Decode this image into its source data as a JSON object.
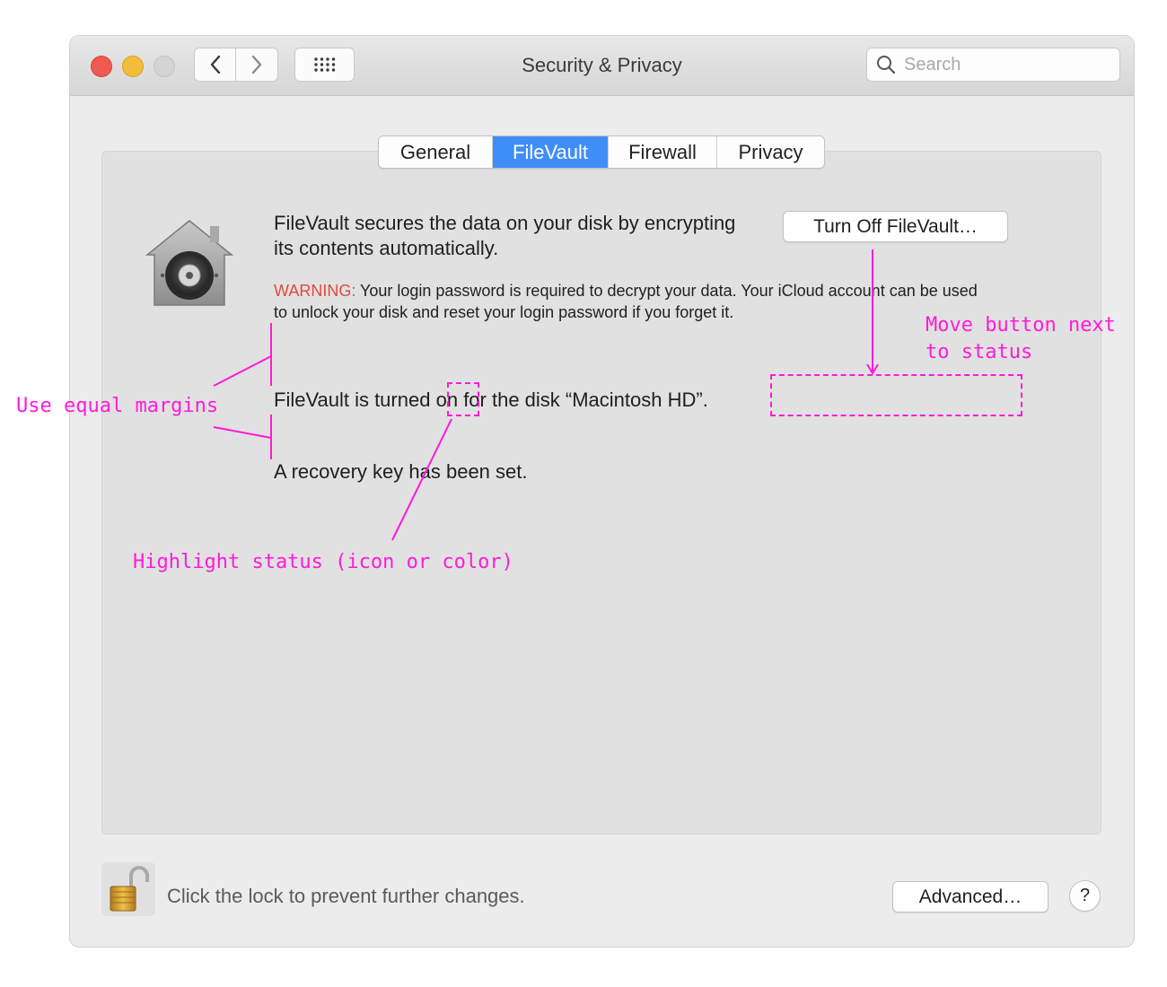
{
  "window": {
    "title": "Security & Privacy"
  },
  "toolbar": {
    "back_icon": "chevron-left-icon",
    "forward_icon": "chevron-right-icon",
    "grid_icon": "grid-icon",
    "search": {
      "placeholder": "Search",
      "value": "",
      "icon": "search-icon"
    }
  },
  "tabs": [
    {
      "label": "General",
      "active": false
    },
    {
      "label": "FileVault",
      "active": true
    },
    {
      "label": "Firewall",
      "active": false
    },
    {
      "label": "Privacy",
      "active": false
    }
  ],
  "filevault": {
    "icon": "filevault-vault-icon",
    "description": "FileVault secures the data on your disk by encrypting its contents automatically.",
    "turn_off_button": "Turn Off FileVault…",
    "warning_label": "WARNING:",
    "warning_text": " Your login password is required to decrypt your data. Your iCloud account can be used to unlock your disk and reset your login password if you forget it.",
    "status_prefix": "FileVault is turned",
    "status_value": "on",
    "status_suffix": "for the disk “Macintosh HD”.",
    "recovery": "A recovery key has been set."
  },
  "footer": {
    "lock_icon": "unlocked-padlock-icon",
    "lock_label": "Click the lock to prevent further changes.",
    "advanced_button": "Advanced…",
    "help_button": "?"
  },
  "annotations": {
    "equal_margins": "Use equal margins",
    "move_button": "Move button next\nto status",
    "highlight_status": "Highlight status (icon or color)"
  },
  "colors": {
    "accent": "#3f8ef7",
    "warning": "#e04b3c",
    "annotation": "#ff1bd8",
    "traffic_red": "#ee5a52",
    "traffic_yellow": "#f2bd3b"
  }
}
